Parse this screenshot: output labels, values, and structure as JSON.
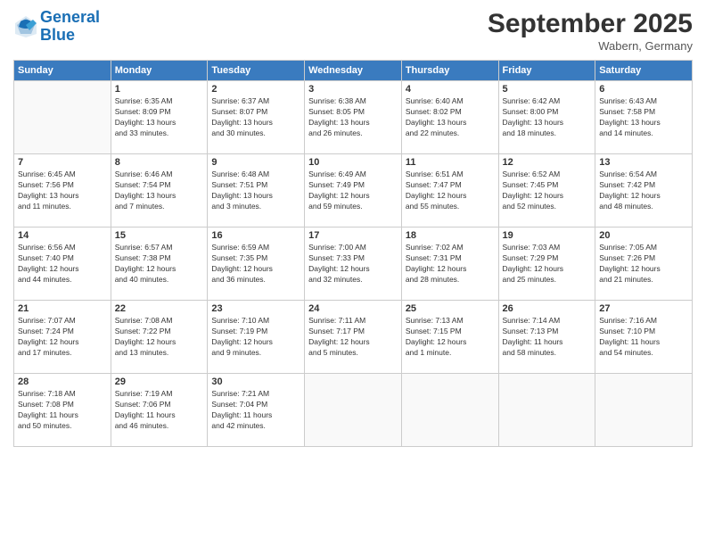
{
  "logo": {
    "line1": "General",
    "line2": "Blue"
  },
  "title": "September 2025",
  "subtitle": "Wabern, Germany",
  "weekdays": [
    "Sunday",
    "Monday",
    "Tuesday",
    "Wednesday",
    "Thursday",
    "Friday",
    "Saturday"
  ],
  "weeks": [
    [
      {
        "day": "",
        "info": ""
      },
      {
        "day": "1",
        "info": "Sunrise: 6:35 AM\nSunset: 8:09 PM\nDaylight: 13 hours\nand 33 minutes."
      },
      {
        "day": "2",
        "info": "Sunrise: 6:37 AM\nSunset: 8:07 PM\nDaylight: 13 hours\nand 30 minutes."
      },
      {
        "day": "3",
        "info": "Sunrise: 6:38 AM\nSunset: 8:05 PM\nDaylight: 13 hours\nand 26 minutes."
      },
      {
        "day": "4",
        "info": "Sunrise: 6:40 AM\nSunset: 8:02 PM\nDaylight: 13 hours\nand 22 minutes."
      },
      {
        "day": "5",
        "info": "Sunrise: 6:42 AM\nSunset: 8:00 PM\nDaylight: 13 hours\nand 18 minutes."
      },
      {
        "day": "6",
        "info": "Sunrise: 6:43 AM\nSunset: 7:58 PM\nDaylight: 13 hours\nand 14 minutes."
      }
    ],
    [
      {
        "day": "7",
        "info": "Sunrise: 6:45 AM\nSunset: 7:56 PM\nDaylight: 13 hours\nand 11 minutes."
      },
      {
        "day": "8",
        "info": "Sunrise: 6:46 AM\nSunset: 7:54 PM\nDaylight: 13 hours\nand 7 minutes."
      },
      {
        "day": "9",
        "info": "Sunrise: 6:48 AM\nSunset: 7:51 PM\nDaylight: 13 hours\nand 3 minutes."
      },
      {
        "day": "10",
        "info": "Sunrise: 6:49 AM\nSunset: 7:49 PM\nDaylight: 12 hours\nand 59 minutes."
      },
      {
        "day": "11",
        "info": "Sunrise: 6:51 AM\nSunset: 7:47 PM\nDaylight: 12 hours\nand 55 minutes."
      },
      {
        "day": "12",
        "info": "Sunrise: 6:52 AM\nSunset: 7:45 PM\nDaylight: 12 hours\nand 52 minutes."
      },
      {
        "day": "13",
        "info": "Sunrise: 6:54 AM\nSunset: 7:42 PM\nDaylight: 12 hours\nand 48 minutes."
      }
    ],
    [
      {
        "day": "14",
        "info": "Sunrise: 6:56 AM\nSunset: 7:40 PM\nDaylight: 12 hours\nand 44 minutes."
      },
      {
        "day": "15",
        "info": "Sunrise: 6:57 AM\nSunset: 7:38 PM\nDaylight: 12 hours\nand 40 minutes."
      },
      {
        "day": "16",
        "info": "Sunrise: 6:59 AM\nSunset: 7:35 PM\nDaylight: 12 hours\nand 36 minutes."
      },
      {
        "day": "17",
        "info": "Sunrise: 7:00 AM\nSunset: 7:33 PM\nDaylight: 12 hours\nand 32 minutes."
      },
      {
        "day": "18",
        "info": "Sunrise: 7:02 AM\nSunset: 7:31 PM\nDaylight: 12 hours\nand 28 minutes."
      },
      {
        "day": "19",
        "info": "Sunrise: 7:03 AM\nSunset: 7:29 PM\nDaylight: 12 hours\nand 25 minutes."
      },
      {
        "day": "20",
        "info": "Sunrise: 7:05 AM\nSunset: 7:26 PM\nDaylight: 12 hours\nand 21 minutes."
      }
    ],
    [
      {
        "day": "21",
        "info": "Sunrise: 7:07 AM\nSunset: 7:24 PM\nDaylight: 12 hours\nand 17 minutes."
      },
      {
        "day": "22",
        "info": "Sunrise: 7:08 AM\nSunset: 7:22 PM\nDaylight: 12 hours\nand 13 minutes."
      },
      {
        "day": "23",
        "info": "Sunrise: 7:10 AM\nSunset: 7:19 PM\nDaylight: 12 hours\nand 9 minutes."
      },
      {
        "day": "24",
        "info": "Sunrise: 7:11 AM\nSunset: 7:17 PM\nDaylight: 12 hours\nand 5 minutes."
      },
      {
        "day": "25",
        "info": "Sunrise: 7:13 AM\nSunset: 7:15 PM\nDaylight: 12 hours\nand 1 minute."
      },
      {
        "day": "26",
        "info": "Sunrise: 7:14 AM\nSunset: 7:13 PM\nDaylight: 11 hours\nand 58 minutes."
      },
      {
        "day": "27",
        "info": "Sunrise: 7:16 AM\nSunset: 7:10 PM\nDaylight: 11 hours\nand 54 minutes."
      }
    ],
    [
      {
        "day": "28",
        "info": "Sunrise: 7:18 AM\nSunset: 7:08 PM\nDaylight: 11 hours\nand 50 minutes."
      },
      {
        "day": "29",
        "info": "Sunrise: 7:19 AM\nSunset: 7:06 PM\nDaylight: 11 hours\nand 46 minutes."
      },
      {
        "day": "30",
        "info": "Sunrise: 7:21 AM\nSunset: 7:04 PM\nDaylight: 11 hours\nand 42 minutes."
      },
      {
        "day": "",
        "info": ""
      },
      {
        "day": "",
        "info": ""
      },
      {
        "day": "",
        "info": ""
      },
      {
        "day": "",
        "info": ""
      }
    ]
  ]
}
